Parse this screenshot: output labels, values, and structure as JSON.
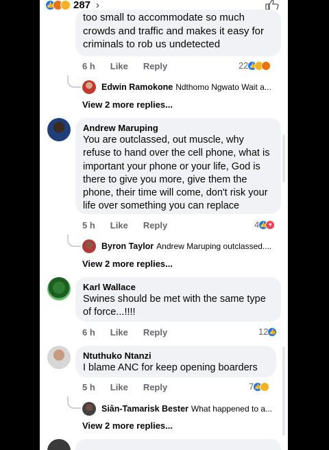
{
  "top": {
    "reaction_count": "287",
    "chevron": "›"
  },
  "comments": [
    {
      "text_partial": "too small to accommodate so much crowds and traffic and makes it easy for criminals to rob us undetected",
      "time": "6 h",
      "like": "Like",
      "reply": "Reply",
      "reactions": "22",
      "reply_preview": {
        "name": "Edwin Ramokone",
        "text": "Ndthomo Ngwato Wait a..."
      },
      "more": "View 2 more replies..."
    },
    {
      "author": "Andrew Maruping",
      "text": "You are outclassed, out muscle, why refuse to hand over the cell phone, what is important your phone or your life, God is there to give you more, give them the phone, their time will come, don't risk your life over something you can replace",
      "time": "5 h",
      "like": "Like",
      "reply": "Reply",
      "reactions": "4",
      "reply_preview": {
        "name": "Byron Taylor",
        "text": "Andrew Maruping outclassed...."
      },
      "more": "View 2 more replies..."
    },
    {
      "author": "Karl Wallace",
      "text": "Swines should be met with the same type of force...!!!!",
      "time": "6 h",
      "like": "Like",
      "reply": "Reply",
      "reactions": "12"
    },
    {
      "author": "Ntuthuko Ntanzi",
      "text": "I blame ANC for keep opening boarders",
      "time": "5 h",
      "like": "Like",
      "reply": "Reply",
      "reactions": "7",
      "reply_preview": {
        "name": "Siân-Tamarisk Bester",
        "text": "What happened to a..."
      },
      "more": "View 2 more replies..."
    }
  ],
  "colors": {
    "like_blue": "#1877f2",
    "bubble": "#f0f2f5",
    "meta": "#65676b"
  }
}
